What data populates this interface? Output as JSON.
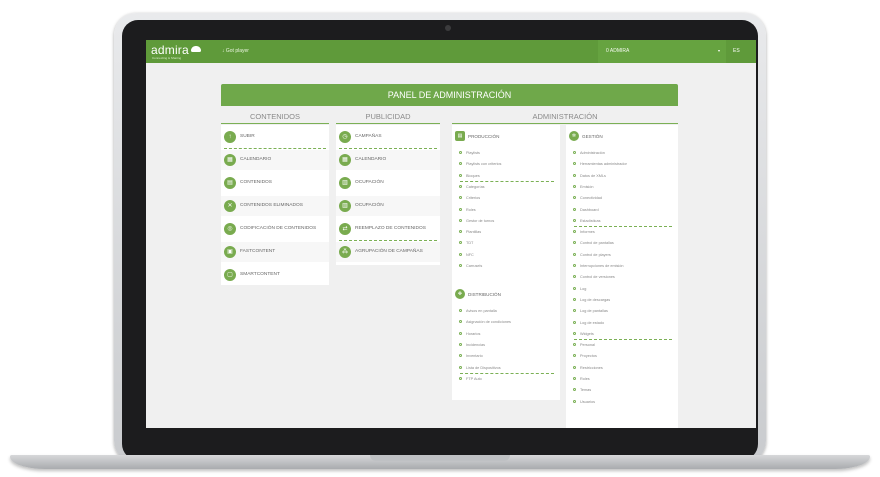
{
  "topbar": {
    "logo": "admira",
    "tagline": "Connecting & Sharing",
    "got_player": "Got player",
    "account": "0 ADMIRA",
    "account_caret": "▾",
    "lang": "ES"
  },
  "panel": {
    "title": "PANEL DE ADMINISTRACIÓN",
    "contenidos": {
      "title": "CONTENIDOS",
      "items": [
        "SUBIR",
        "CALENDARIO",
        "CONTENIDOS",
        "CONTENIDOS ELIMINADOS",
        "CODIFICACIÓN DE CONTENIDOS",
        "FASTCONTENT",
        "SMARTCONTENT"
      ]
    },
    "publicidad": {
      "title": "PUBLICIDAD",
      "items": [
        "CAMPAÑAS",
        "CALENDARIO",
        "OCUPACIÓN",
        "OCUPACIÓN",
        "REEMPLAZO DE CONTENIDOS",
        "AGRUPACIÓN DE CAMPAÑAS"
      ]
    },
    "administracion": {
      "title": "ADMINISTRACIÓN",
      "produccion": {
        "title": "PRODUCCIÓN",
        "items": [
          "Playlists",
          "Playlists con criterios",
          "Bloques",
          "Categorías",
          "Criterios",
          "Roles",
          "Gestor de turnos",
          "Plantillas",
          "TDT",
          "NFC",
          "Carrusels"
        ]
      },
      "distribucion": {
        "title": "DISTRIBUCIÓN",
        "items": [
          "Avisos en pantalla",
          "Asignación de condiciones",
          "Horarios",
          "Incidencias",
          "Inventario",
          "Lista de Dispositivos",
          "FTP Auto"
        ]
      },
      "gestion": {
        "title": "GESTIÓN",
        "items": [
          "Administración",
          "Herramientas administrador",
          "Datos de XMLs",
          "Emisión",
          "Conectividad",
          "Dashboard",
          "Estadísticas",
          "Informes",
          "Control de pantallas",
          "Control de players",
          "Interrupciones de emisión",
          "Control de versiones",
          "Log",
          "Log de descargas",
          "Log de pantallas",
          "Log de estado",
          "Widgets",
          "Personal",
          "Proyectos",
          "Restricciones",
          "Roles",
          "Temas",
          "Usuarios"
        ]
      }
    }
  },
  "colors": {
    "brand": "#5f9a3a",
    "accent": "#79ab4f"
  }
}
